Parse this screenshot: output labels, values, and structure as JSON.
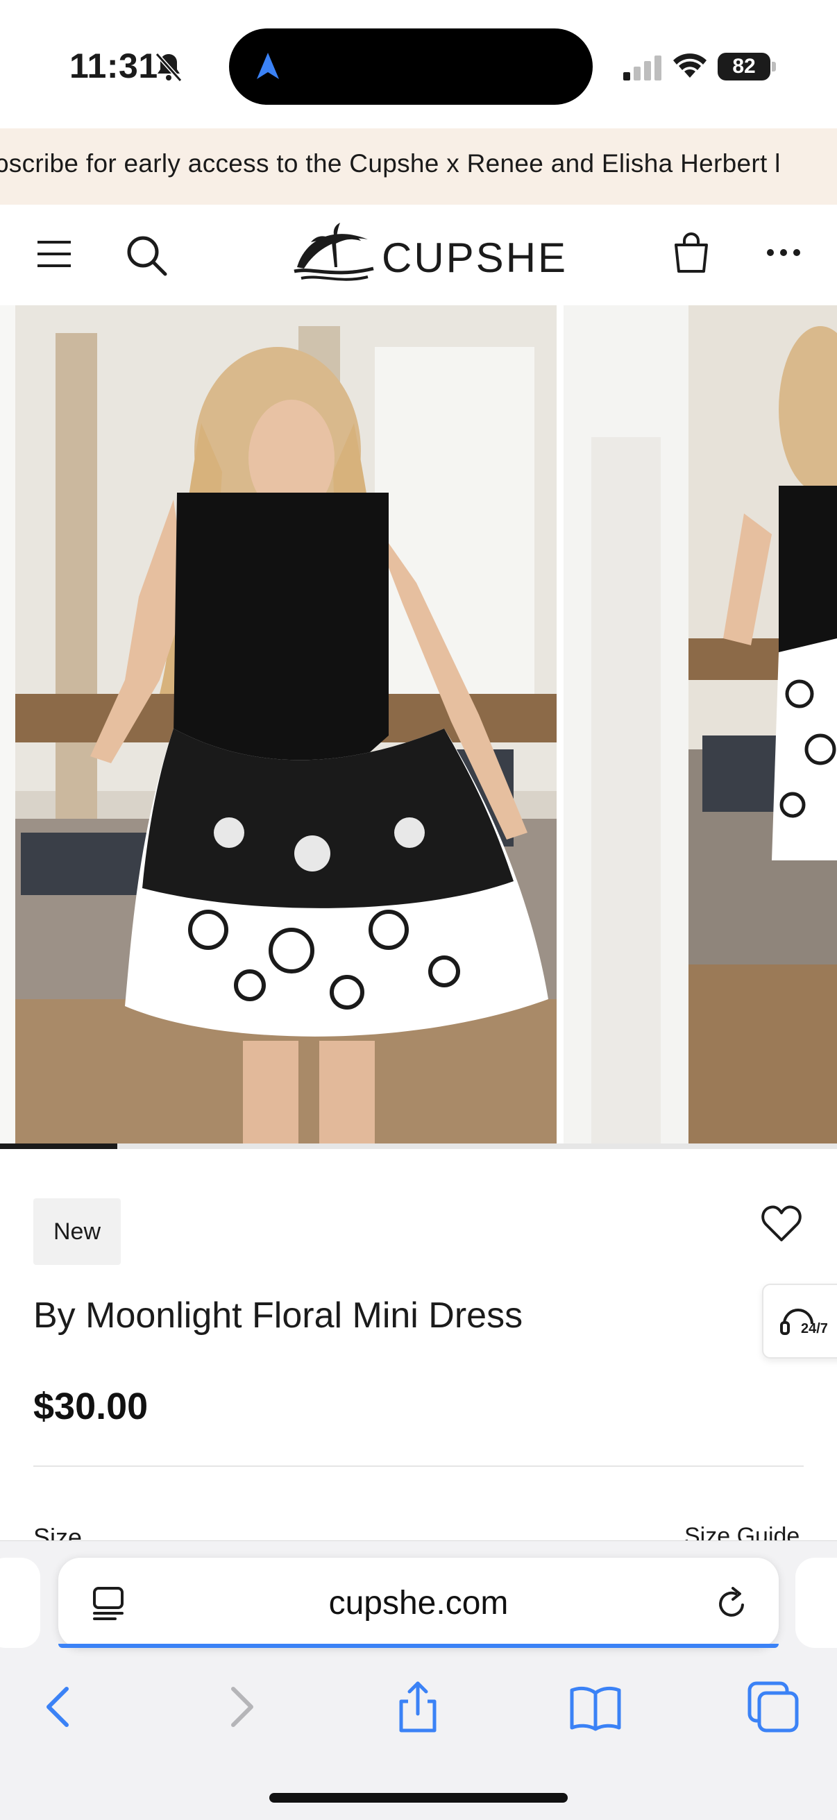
{
  "status_bar": {
    "time": "11:31",
    "battery": "82"
  },
  "promo_banner": {
    "text": "ɔscribe for early access to the Cupshe x Renee and Elisha Herbert l"
  },
  "header": {
    "brand": "CUPSHE",
    "icons": [
      "menu-icon",
      "search-icon",
      "shopping-bag-icon",
      "more-icon"
    ]
  },
  "gallery": {
    "image_count_visible": 2,
    "progress": 0.14
  },
  "product": {
    "badge": "New",
    "title": "By Moonlight Floral Mini Dress",
    "price": "$30.00",
    "size_label": "Size",
    "size_guide": "Size Guide",
    "chat_label": "24/7"
  },
  "browser": {
    "url": "cupshe.com",
    "toolbar": [
      "back-icon",
      "forward-icon",
      "share-icon",
      "bookmarks-icon",
      "tabs-icon"
    ]
  },
  "colors": {
    "promo_bg": "#f8efe6",
    "accent_blue": "#3b82f6",
    "text": "#1b1b1b"
  }
}
